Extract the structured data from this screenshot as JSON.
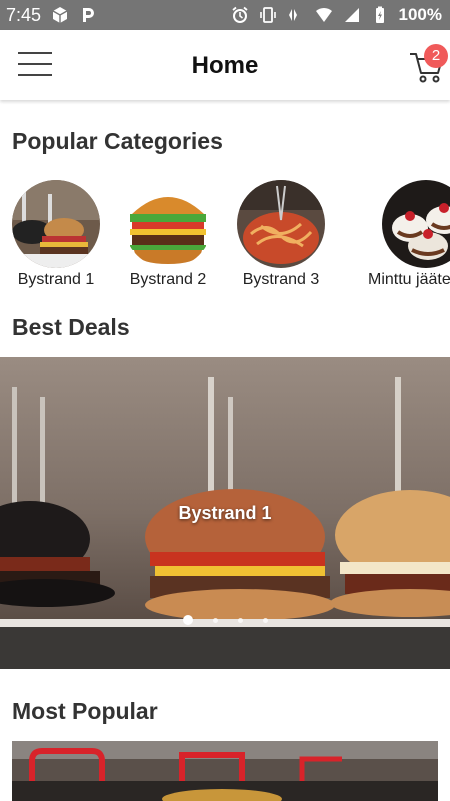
{
  "status_bar": {
    "time": "7:45",
    "battery": "100%",
    "icons": [
      "box-icon",
      "parking-icon",
      "alarm-icon",
      "vibrate-icon",
      "wifi-icon",
      "signal-icon",
      "battery-icon"
    ]
  },
  "header": {
    "title": "Home",
    "cart_count": "2",
    "icons": [
      "hamburger-menu-icon",
      "cart-icon"
    ]
  },
  "popular_categories": {
    "title": "Popular Categories",
    "items": [
      {
        "label": "Bystrand 1",
        "image": "burger-sliders-thumb"
      },
      {
        "label": "Bystrand 2",
        "image": "burger-thumb"
      },
      {
        "label": "Bystrand 3",
        "image": "spaghetti-thumb"
      },
      {
        "label": "Minttu jäätelö",
        "image": "ice-cream-thumb"
      }
    ]
  },
  "best_deals": {
    "title": "Best Deals",
    "slide_caption": "Bystrand 1",
    "slide_count": 4,
    "active_slide": 0
  },
  "most_popular": {
    "title": "Most Popular"
  },
  "colors": {
    "status_bar": "#757575",
    "badge": "#f05a5a",
    "text": "#333333"
  }
}
